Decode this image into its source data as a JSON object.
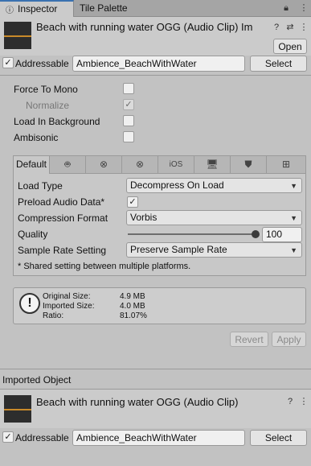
{
  "tabs": [
    {
      "label": "Inspector",
      "active": true
    },
    {
      "label": "Tile Palette",
      "active": false
    }
  ],
  "header": {
    "title": "Beach with running water OGG (Audio Clip) Im",
    "open_label": "Open"
  },
  "addressable": {
    "label": "Addressable",
    "checked": true,
    "value": "Ambience_BeachWithWater",
    "select_label": "Select"
  },
  "options": {
    "force_to_mono": "Force To Mono",
    "normalize": "Normalize",
    "load_in_background": "Load In Background",
    "ambisonic": "Ambisonic"
  },
  "platform_tabs": [
    {
      "label": "Default",
      "icon": "default"
    },
    {
      "label": "",
      "icon": "android-icon"
    },
    {
      "label": "",
      "icon": "xbox-icon"
    },
    {
      "label": "",
      "icon": "xbox-icon"
    },
    {
      "label": "iOS",
      "icon": "ios"
    },
    {
      "label": "",
      "icon": "monitor-icon"
    },
    {
      "label": "",
      "icon": "html5-icon"
    },
    {
      "label": "",
      "icon": "windows-icon"
    }
  ],
  "settings": {
    "load_type_label": "Load Type",
    "load_type_value": "Decompress On Load",
    "preload_label": "Preload Audio Data*",
    "compression_label": "Compression Format",
    "compression_value": "Vorbis",
    "quality_label": "Quality",
    "quality_value": "100",
    "sample_rate_label": "Sample Rate Setting",
    "sample_rate_value": "Preserve Sample Rate",
    "footnote": "* Shared setting between multiple platforms."
  },
  "info": {
    "original_label": "Original Size:",
    "original_value": "4.9 MB",
    "imported_label": "Imported Size:",
    "imported_value": "4.0 MB",
    "ratio_label": "Ratio:",
    "ratio_value": "81.07%"
  },
  "actions": {
    "revert_label": "Revert",
    "apply_label": "Apply"
  },
  "imported_object": {
    "section_title": "Imported Object",
    "title": "Beach with running water OGG (Audio Clip)",
    "addressable_label": "Addressable",
    "addressable_value": "Ambience_BeachWithWater",
    "select_label": "Select"
  },
  "colors": {
    "accent": "#3a72b0",
    "waveform": "#c98a2a"
  }
}
